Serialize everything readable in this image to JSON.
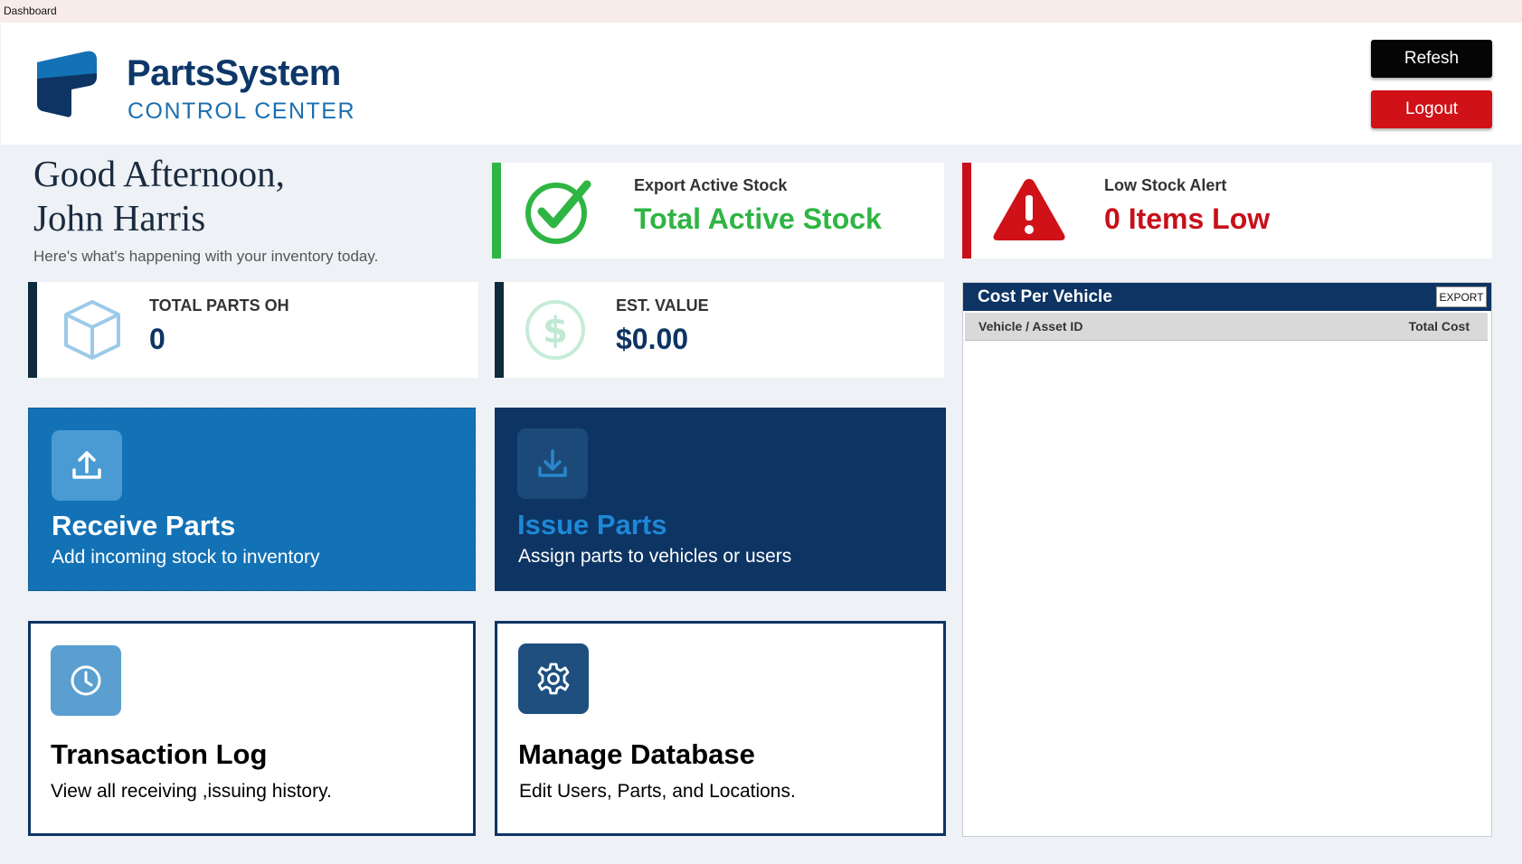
{
  "window": {
    "title": "Dashboard"
  },
  "brand": {
    "name": "PartsSystem",
    "subtitle": "CONTROL CENTER"
  },
  "header": {
    "refresh_label": "Refesh",
    "logout_label": "Logout"
  },
  "greeting": {
    "line1": "Good Afternoon,",
    "line2": "John Harris",
    "subtitle": "Here's what's happening with your inventory today."
  },
  "stats": {
    "active_stock": {
      "label": "Export Active Stock",
      "value": "Total Active Stock",
      "color": "#2fb543"
    },
    "low_stock": {
      "label": "Low Stock Alert",
      "value": "0 Items Low",
      "color": "#c8101a"
    },
    "total_parts": {
      "label": "TOTAL PARTS OH",
      "value": "0"
    },
    "est_value": {
      "label": "EST. VALUE",
      "value": "$0.00"
    }
  },
  "tiles": {
    "receive": {
      "title": "Receive Parts",
      "desc": "Add incoming stock to inventory",
      "icon": "upload-icon"
    },
    "issue": {
      "title": "Issue Parts",
      "desc": "Assign parts to vehicles or users",
      "icon": "download-icon"
    },
    "log": {
      "title": "Transaction Log",
      "desc": "View all receiving ,issuing history.",
      "icon": "clock-icon"
    },
    "manage": {
      "title": "Manage Database",
      "desc": "Edit Users, Parts, and Locations.",
      "icon": "gear-icon"
    }
  },
  "cost_panel": {
    "title": "Cost Per Vehicle",
    "export_label": "EXPORT",
    "columns": [
      "Vehicle / Asset ID",
      "Total Cost"
    ],
    "rows": []
  },
  "colors": {
    "navy": "#0d3463",
    "blue": "#1372b6",
    "green": "#2fb543",
    "red": "#c8101a"
  }
}
